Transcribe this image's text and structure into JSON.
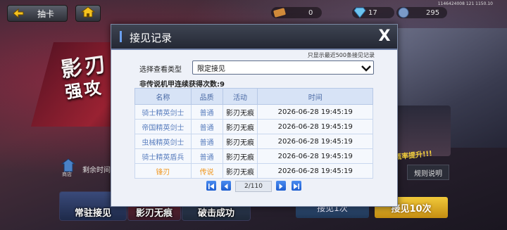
{
  "topbar": {
    "back_label": "抽卡",
    "coords": "1146424008 121 1150.10",
    "resources": [
      {
        "name": "ticket",
        "value": "0"
      },
      {
        "name": "diamond",
        "value": "17"
      },
      {
        "name": "crystal",
        "value": "295"
      }
    ]
  },
  "background": {
    "title_line1": "影刃",
    "title_line2": "强攻",
    "promo_text": "概率提升!!!",
    "shop_label": "商店",
    "remain_label": "剩余时间",
    "rule_button": "规则说明",
    "draw1_button": "接见1次",
    "draw10_button": "接见10次",
    "tiles": [
      "常驻接见",
      "影刃无痕",
      "破击成功"
    ]
  },
  "modal": {
    "title": "接见记录",
    "close": "X",
    "note": "只显示最近500条接见记录",
    "filter_label": "选择查看类型",
    "filter_value": "限定接见",
    "summary": "非传说机甲连续获得次数:9",
    "columns": [
      "名称",
      "品质",
      "活动",
      "时间"
    ],
    "rows": [
      {
        "name": "骑士精英剑士",
        "quality": "普通",
        "activity": "影刃无痕",
        "time": "2026-06-28 19:45:19",
        "legend": false
      },
      {
        "name": "帝国精英剑士",
        "quality": "普通",
        "activity": "影刃无痕",
        "time": "2026-06-28 19:45:19",
        "legend": false
      },
      {
        "name": "虫械精英剑士",
        "quality": "普通",
        "activity": "影刃无痕",
        "time": "2026-06-28 19:45:19",
        "legend": false
      },
      {
        "name": "骑士精英盾兵",
        "quality": "普通",
        "activity": "影刃无痕",
        "time": "2026-06-28 19:45:19",
        "legend": false
      },
      {
        "name": "锋刃",
        "quality": "传说",
        "activity": "影刃无痕",
        "time": "2026-06-28 19:45:19",
        "legend": true
      }
    ],
    "pagination": {
      "text": "2/110"
    }
  },
  "colors": {
    "accent_blue": "#4a8bf0",
    "legend_orange": "#f0961e",
    "common_blue": "#5b7fbf"
  }
}
